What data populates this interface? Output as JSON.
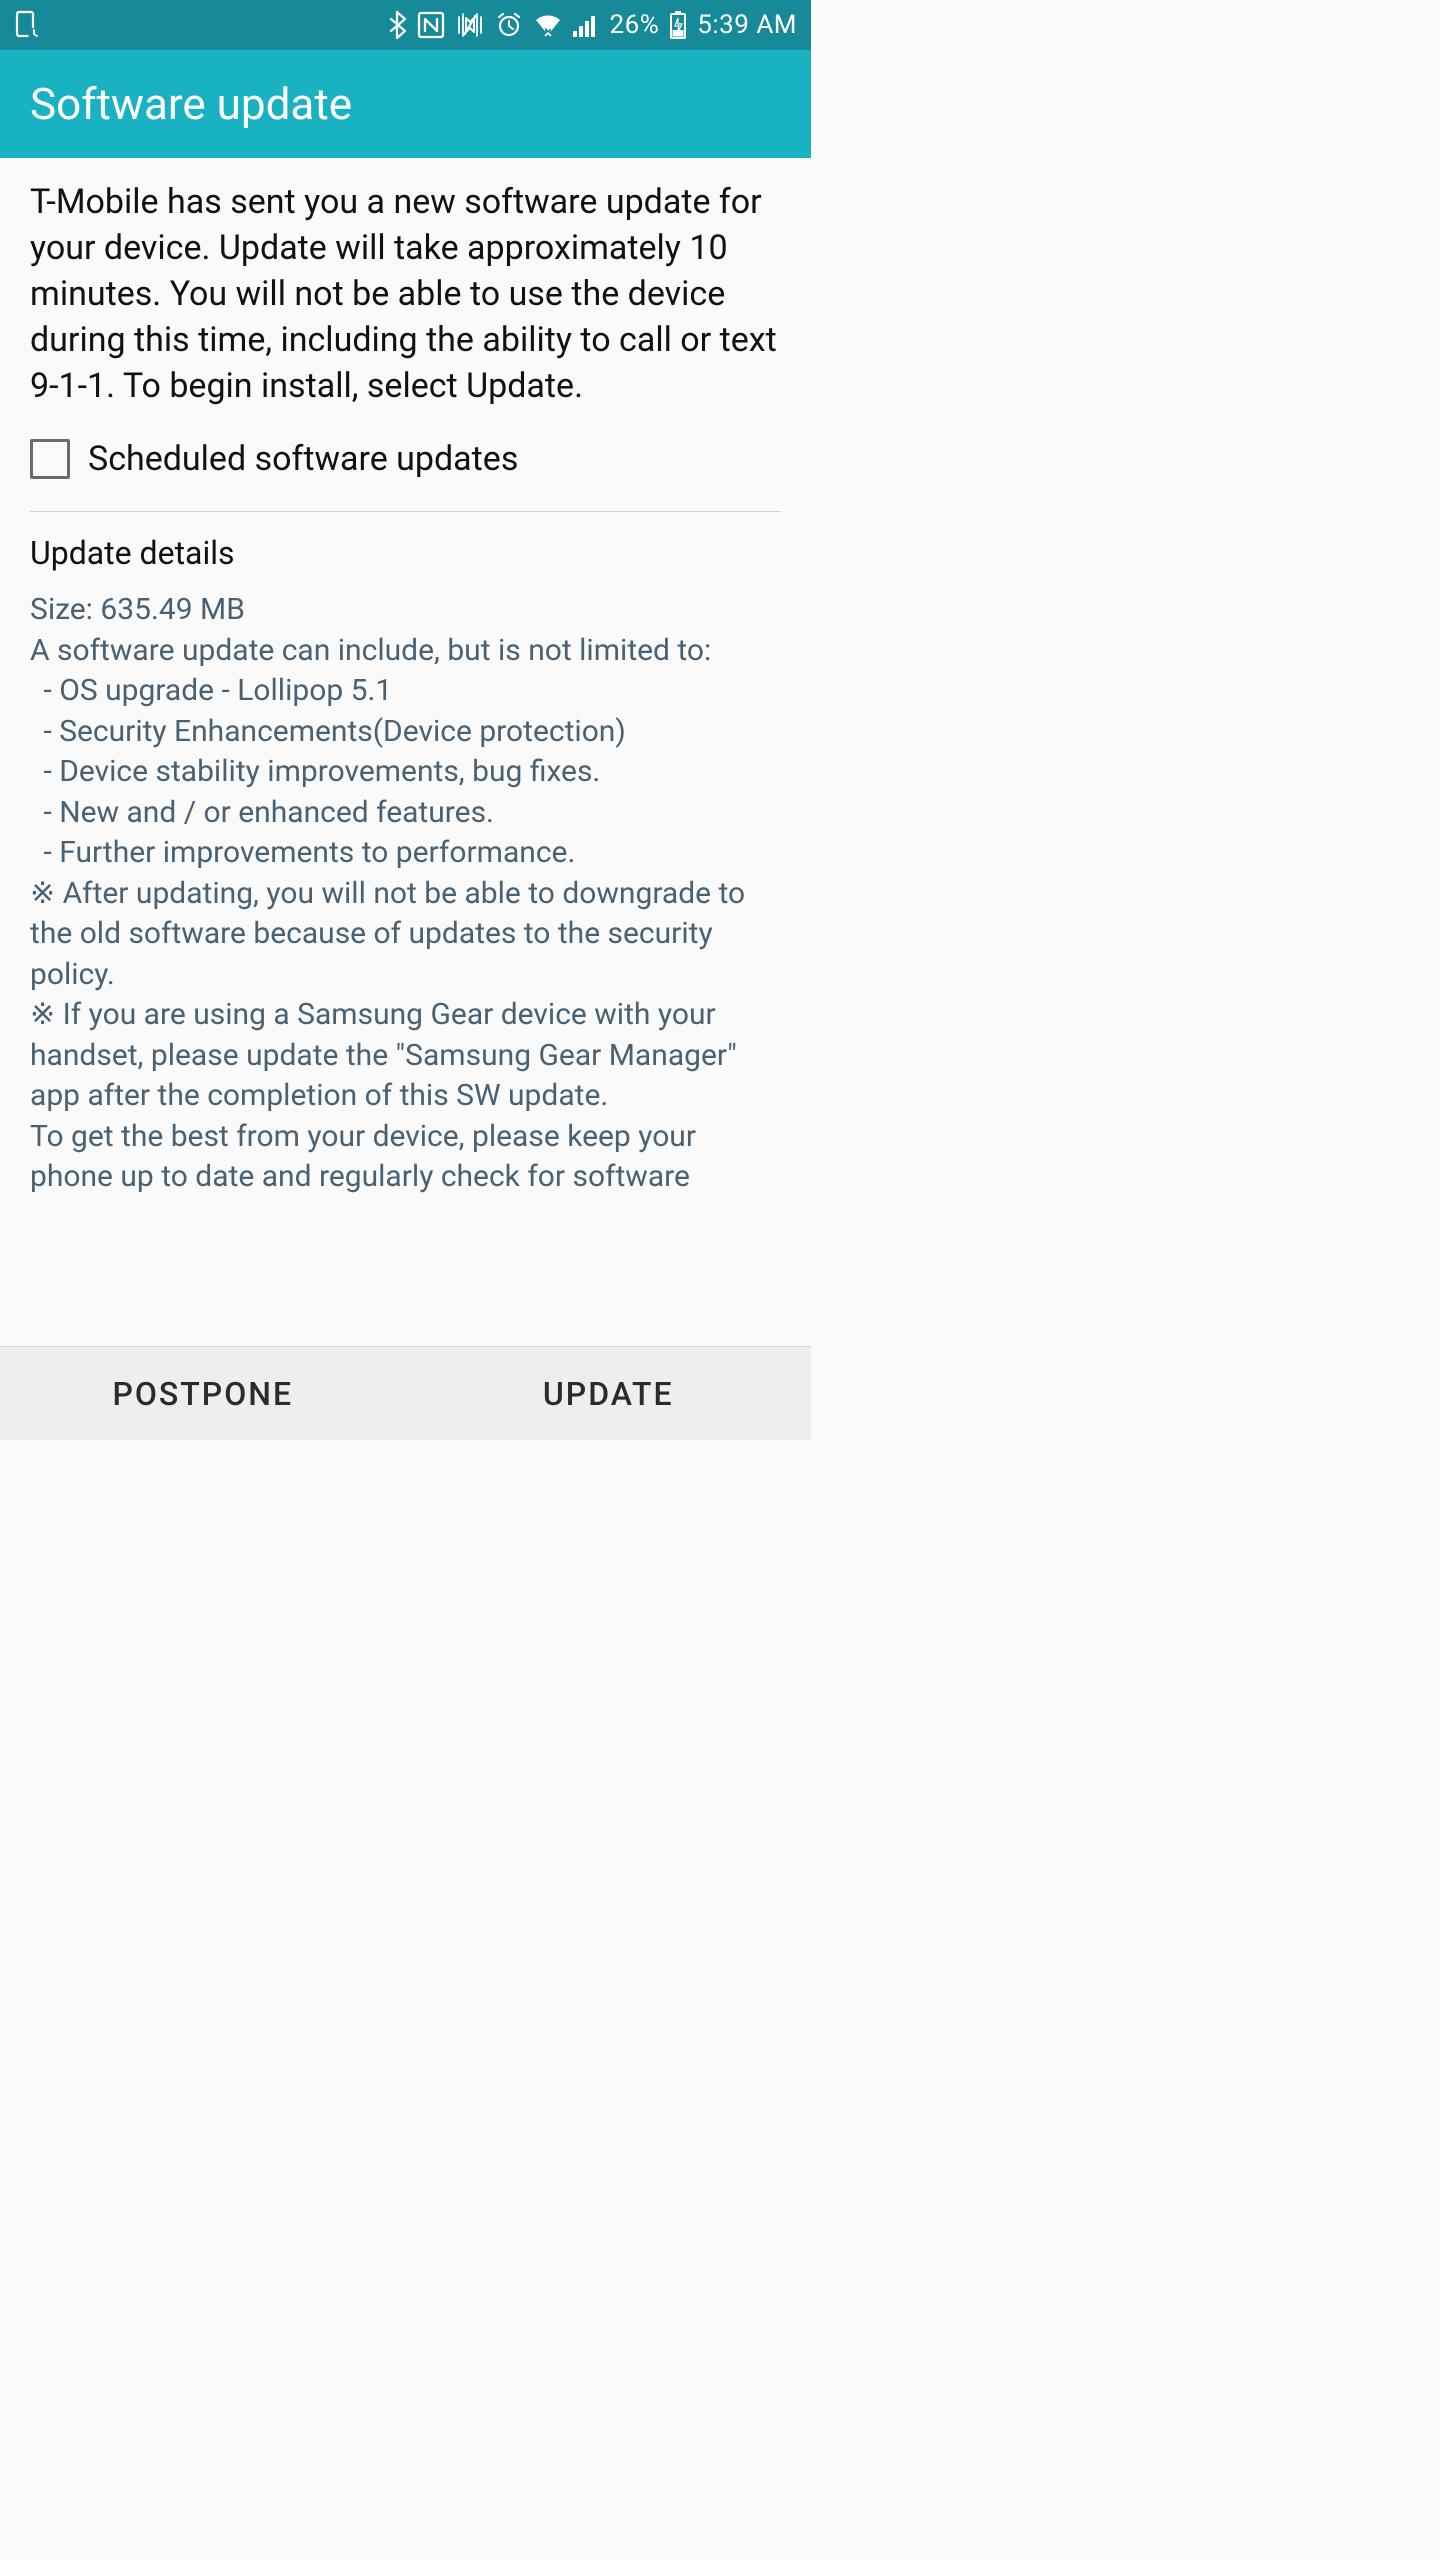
{
  "status_bar": {
    "battery_pct": "26%",
    "time": "5:39 AM"
  },
  "app_bar": {
    "title": "Software update"
  },
  "main": {
    "intro": "T-Mobile has sent you a new software update for your device. Update will take approximately 10 minutes. You will not be able to use the device during this time, including the ability to call or text 9-1-1. To begin install, select Update.",
    "scheduled_label": "Scheduled software updates",
    "details_title": "Update details",
    "details": {
      "size_line": "Size: 635.49 MB",
      "intro_line": "A software update can include, but is not limited to:",
      "bullets": [
        "OS upgrade - Lollipop 5.1",
        "Security Enhancements(Device protection)",
        "Device stability improvements, bug fixes.",
        "New and / or enhanced features.",
        "Further improvements to performance."
      ],
      "notes": [
        "※ After updating, you will not be able to downgrade to the old software because of updates to the security policy.",
        "※ If you are using a Samsung Gear device with your handset, please update the \"Samsung Gear Manager\" app after the completion of this SW update."
      ],
      "footer": "To get the best from your device, please keep your phone up to date and regularly check for software"
    }
  },
  "buttons": {
    "postpone": "POSTPONE",
    "update": "UPDATE"
  }
}
